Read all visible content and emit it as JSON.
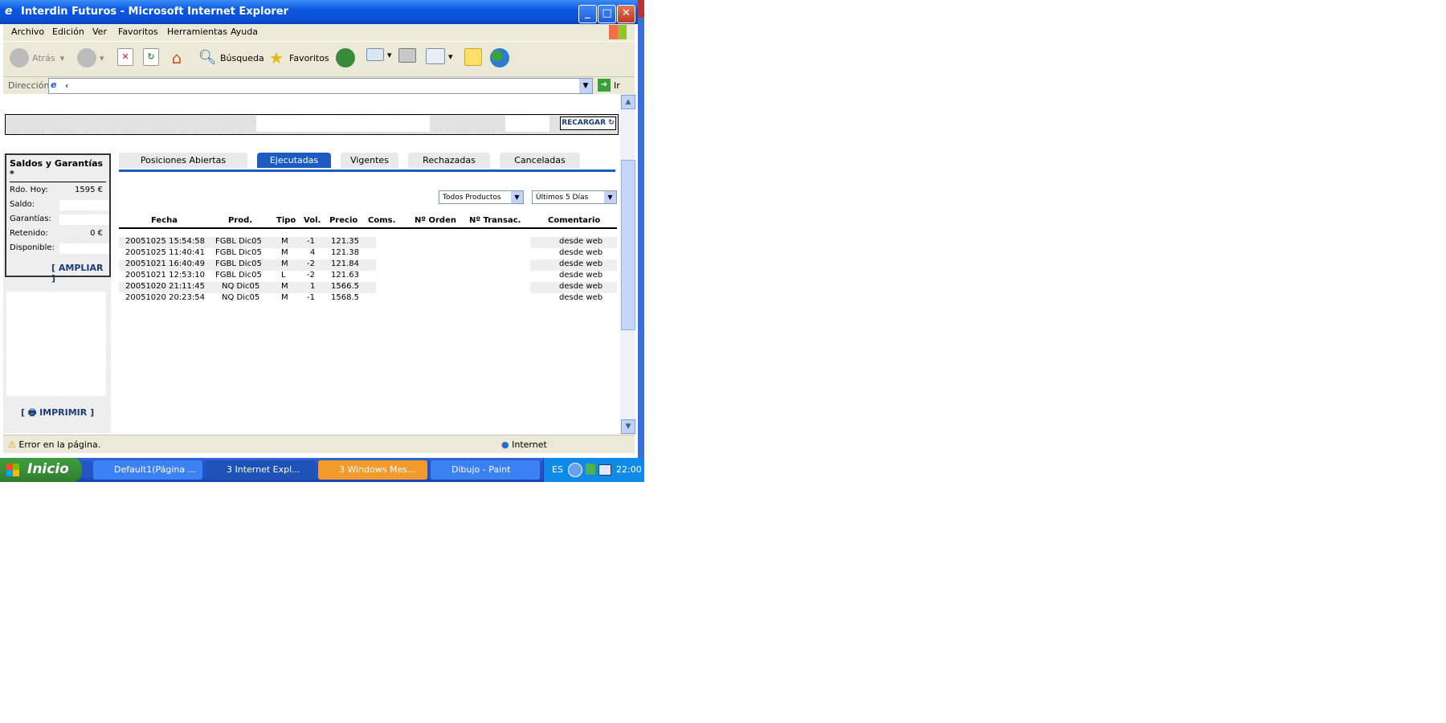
{
  "window": {
    "title": "Interdin Futuros - Microsoft Internet Explorer",
    "buttons": {
      "minimize": "_",
      "maximize": "□",
      "close": "✕"
    }
  },
  "menu": [
    "Archivo",
    "Edición",
    "Ver",
    "Favoritos",
    "Herramientas",
    "Ayuda"
  ],
  "toolbar": {
    "back": "Atrás",
    "search": "Búsqueda",
    "favorites": "Favoritos"
  },
  "address": {
    "label": "Dirección",
    "value": "‹",
    "go": "Ir"
  },
  "page": {
    "recargar": "RECARGAR ↻",
    "saldos": {
      "title": "Saldos y Garantías *",
      "rows": [
        {
          "label": "Rdo. Hoy:",
          "value": "1595 €"
        },
        {
          "label": "Saldo:",
          "value": ""
        },
        {
          "label": "Garantías:",
          "value": ""
        },
        {
          "label": "Retenido:",
          "value": "0 €"
        },
        {
          "label": "Disponible:",
          "value": ""
        }
      ],
      "ampliar": "[ AMPLIAR ]"
    },
    "imprimir": "[ 🖶 IMPRIMIR ]",
    "tabs": [
      {
        "label": "Posiciones Abiertas",
        "active": false
      },
      {
        "label": "Ejecutadas",
        "active": true
      },
      {
        "label": "Vigentes",
        "active": false
      },
      {
        "label": "Rechazadas",
        "active": false
      },
      {
        "label": "Canceladas",
        "active": false
      }
    ],
    "filters": {
      "products": "Todos Productos",
      "days": "Últimos 5 Días"
    },
    "table": {
      "headers": [
        "Fecha",
        "Prod.",
        "Tipo",
        "Vol.",
        "Precio",
        "Coms.",
        "Nº Orden",
        "Nº Transac.",
        "Comentario"
      ],
      "rows": [
        [
          "20051025 15:54:58",
          "FGBL Dic05",
          "M",
          "-1",
          "121.35",
          "",
          "",
          "",
          "desde web"
        ],
        [
          "20051025 11:40:41",
          "FGBL Dic05",
          "M",
          "4",
          "121.38",
          "",
          "",
          "",
          "desde web"
        ],
        [
          "20051021 16:40:49",
          "FGBL Dic05",
          "M",
          "-2",
          "121.84",
          "",
          "",
          "",
          "desde web"
        ],
        [
          "20051021 12:53:10",
          "FGBL Dic05",
          "L",
          "-2",
          "121.63",
          "",
          "",
          "",
          "desde web"
        ],
        [
          "20051020 21:11:45",
          "NQ Dic05",
          "M",
          "1",
          "1566.5",
          "",
          "",
          "",
          "desde web"
        ],
        [
          "20051020 20:23:54",
          "NQ Dic05",
          "M",
          "-1",
          "1568.5",
          "",
          "",
          "",
          "desde web"
        ]
      ]
    }
  },
  "status": {
    "message": "Error en la página.",
    "zone": "Internet"
  },
  "taskbar": {
    "start": "Inicio",
    "tasks": [
      "Default1(Página ...",
      "3 Internet Expl...",
      "3 Windows Mes...",
      "Dibujo - Paint"
    ],
    "lang": "ES",
    "clock": "22:00"
  }
}
